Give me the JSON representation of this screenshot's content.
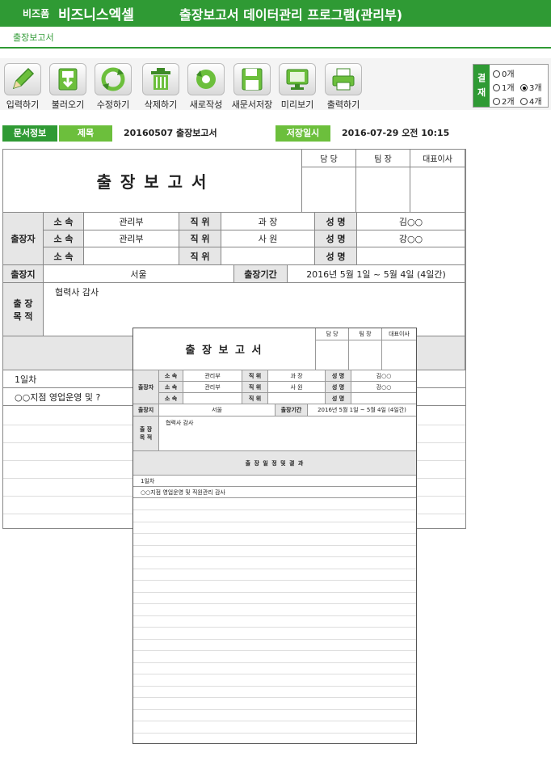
{
  "header": {
    "brand_small": "비즈폼",
    "brand_big": "비즈니스엑셀",
    "app_title": "출장보고서 데이터관리 프로그램(관리부)"
  },
  "subtab": {
    "label": "출장보고서"
  },
  "toolbar": {
    "buttons": [
      {
        "label": "입력하기",
        "icon": "pencil-icon"
      },
      {
        "label": "불러오기",
        "icon": "download-icon"
      },
      {
        "label": "수정하기",
        "icon": "refresh-icon"
      },
      {
        "label": "삭제하기",
        "icon": "trash-icon"
      },
      {
        "label": "새로작성",
        "icon": "new-icon"
      },
      {
        "label": "새문서저장",
        "icon": "save-icon"
      },
      {
        "label": "미리보기",
        "icon": "monitor-icon"
      },
      {
        "label": "출력하기",
        "icon": "printer-icon"
      }
    ]
  },
  "approval": {
    "label_1": "결",
    "label_2": "재",
    "options": [
      "0개",
      "1개",
      "3개",
      "2개",
      "4개"
    ],
    "selected": "3개"
  },
  "docinfo": {
    "section_label": "문서정보",
    "title_label": "제목",
    "title_value": "20160507 출장보고서",
    "saved_label": "저장일시",
    "saved_value": "2016-07-29  오전 10:15"
  },
  "report": {
    "title": "출 장 보 고 서",
    "approvers": [
      "담 당",
      "팀 장",
      "대표이사"
    ],
    "traveler_label": "출장자",
    "dept_label": "소 속",
    "position_label": "직 위",
    "name_label": "성 명",
    "rows": [
      {
        "dept": "관리부",
        "position": "과 장",
        "name": "김○○"
      },
      {
        "dept": "관리부",
        "position": "사 원",
        "name": "강○○"
      },
      {
        "dept": "",
        "position": "",
        "name": ""
      }
    ],
    "place_label": "출장지",
    "place_value": "서울",
    "period_label": "출장기간",
    "period_value": "2016년 5월 1일 ~ 5월 4일 (4일간)",
    "purpose_label_1": "출 장",
    "purpose_label_2": "목 적",
    "purpose_value": "협력사 감사",
    "schedule_label": "출 장 일 정 및 결 과",
    "day1": "1일차",
    "activity1": "○○지점 영업운영 및 직원관리 감사",
    "activity1_cut": "○○지점 영업운영 및 ?"
  },
  "colors": {
    "accent": "#2f9a34",
    "accent_light": "#6cbf3c",
    "header_gray": "#e6e6e6"
  }
}
